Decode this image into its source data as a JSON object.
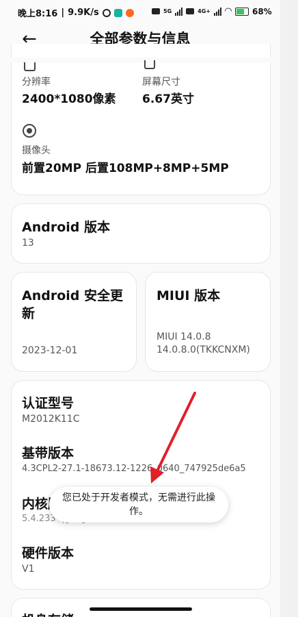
{
  "status": {
    "time": "晚上8:16",
    "speed": "9.9K/s",
    "sig1": "5G",
    "sig2": "4G+",
    "battery": "68%"
  },
  "header": {
    "title": "全部参数与信息"
  },
  "specs": {
    "resolution_label": "分辨率",
    "resolution_value": "2400*1080像素",
    "screen_label": "屏幕尺寸",
    "screen_value": "6.67英寸",
    "camera_label": "摄像头",
    "camera_value": "前置20MP 后置108MP+8MP+5MP"
  },
  "android": {
    "title": "Android 版本",
    "value": "13"
  },
  "security": {
    "title_line1": "Android 安全更",
    "title_line2": "新",
    "value": "2023-12-01"
  },
  "miui": {
    "title": "MIUI 版本",
    "value_line1": "MIUI 14.0.8",
    "value_line2": "14.0.8.0(TKKCNXM)"
  },
  "details": {
    "model_title": "认证型号",
    "model_value": "M2012K11C",
    "baseband_title": "基带版本",
    "baseband_value": "4.3CPL2-27.1-18673.12-1226_0640_747925de6a5",
    "kernel_title": "内核版",
    "kernel_value": "5.4.233-qgki-g85c5c2c40b47",
    "hardware_title": "硬件版本",
    "hardware_value": "V1"
  },
  "toast": {
    "line1": "您已处于开发者模式，无需进行此操",
    "line2": "作。"
  },
  "bottom": {
    "partial_title": "机身存储"
  }
}
